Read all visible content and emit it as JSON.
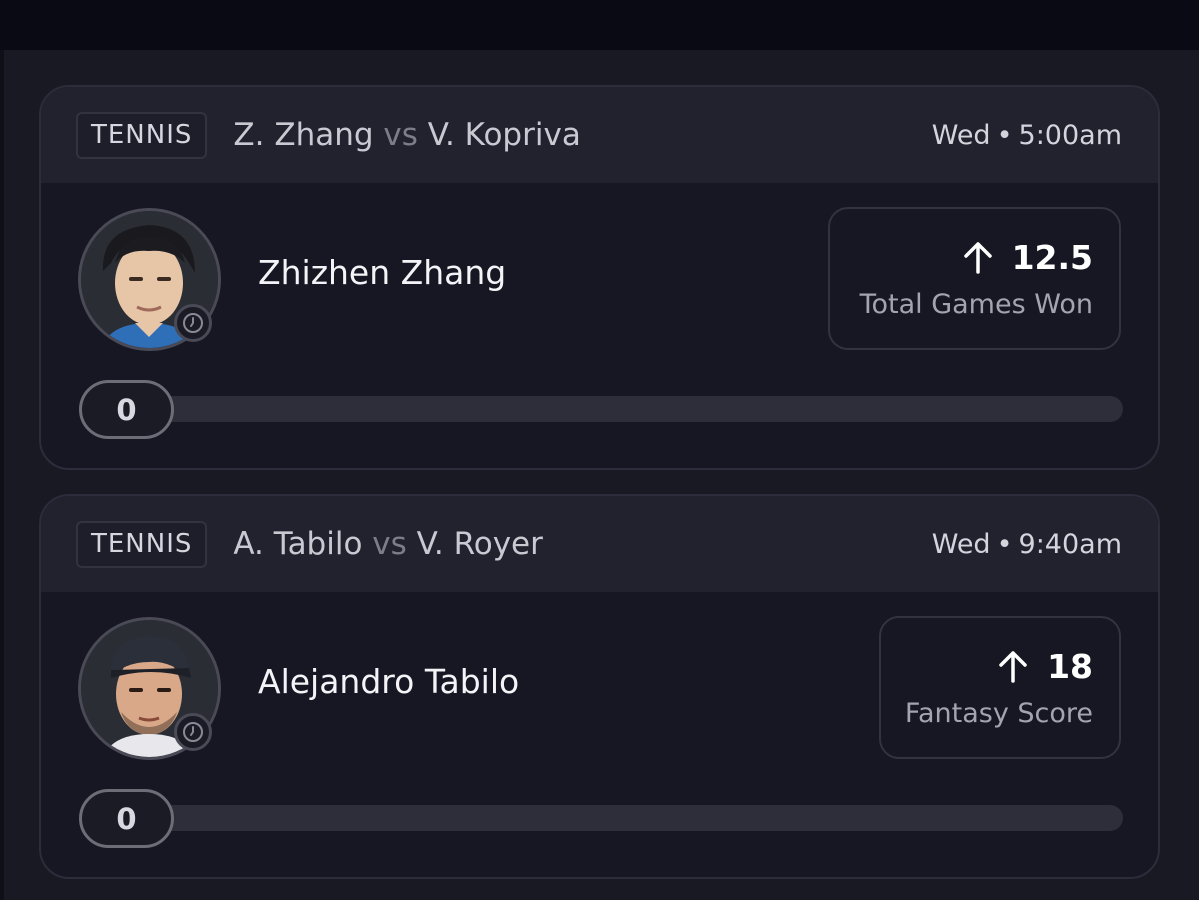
{
  "cards": [
    {
      "sport": "TENNIS",
      "player1": "Z. Zhang",
      "vs": "vs",
      "player2": "V. Kopriva",
      "day": "Wed",
      "separator": "•",
      "time": "5:00am",
      "player_name": "Zhizhen Zhang",
      "direction_icon": "arrow-up-icon",
      "line_value": "12.5",
      "stat_label": "Total Games Won",
      "current_value": "0",
      "progress_fraction": 0
    },
    {
      "sport": "TENNIS",
      "player1": "A. Tabilo",
      "vs": "vs",
      "player2": "V. Royer",
      "day": "Wed",
      "separator": "•",
      "time": "9:40am",
      "player_name": "Alejandro Tabilo",
      "direction_icon": "arrow-up-icon",
      "line_value": "18",
      "stat_label": "Fantasy Score",
      "current_value": "0",
      "progress_fraction": 0
    }
  ],
  "colors": {
    "background": "#191924",
    "card": "#171723",
    "card_header": "#22222f",
    "text_primary": "#ffffff",
    "text_secondary": "#a4a4b0"
  }
}
